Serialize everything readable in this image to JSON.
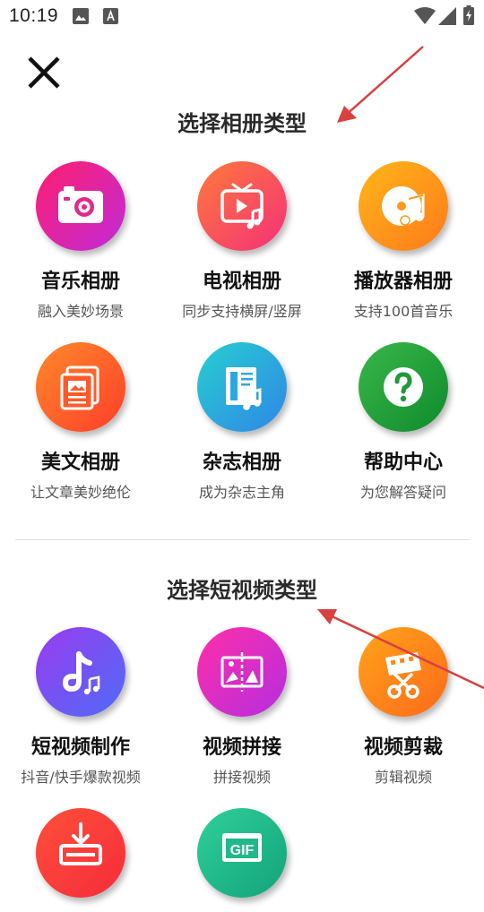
{
  "status_bar": {
    "time": "10:19",
    "icons": [
      "image-notification-icon",
      "a-text-notification-icon",
      "wifi-icon",
      "signal-icon",
      "battery-charging-icon"
    ]
  },
  "close_icon": "close-icon",
  "album_section": {
    "title": "选择相册类型",
    "items": [
      {
        "title": "音乐相册",
        "subtitle": "融入美妙场景",
        "icon": "camera-icon",
        "colors": [
          "#ff1e6e",
          "#c02bd9"
        ]
      },
      {
        "title": "电视相册",
        "subtitle": "同步支持横屏/竖屏",
        "icon": "tv-music-icon",
        "colors": [
          "#ff7a3a",
          "#f4307a"
        ]
      },
      {
        "title": "播放器相册",
        "subtitle": "支持100首音乐",
        "icon": "music-disc-icon",
        "colors": [
          "#ffb61a",
          "#ff7a1a"
        ]
      },
      {
        "title": "美文相册",
        "subtitle": "让文章美妙绝伦",
        "icon": "article-icon",
        "colors": [
          "#ff8a2a",
          "#ff3d2a"
        ]
      },
      {
        "title": "杂志相册",
        "subtitle": "成为杂志主角",
        "icon": "magazine-music-icon",
        "colors": [
          "#27cfd0",
          "#2f86e6"
        ]
      },
      {
        "title": "帮助中心",
        "subtitle": "为您解答疑问",
        "icon": "help-question-icon",
        "colors": [
          "#39b84a",
          "#0f8a2c"
        ]
      }
    ]
  },
  "video_section": {
    "title": "选择短视频类型",
    "items": [
      {
        "title": "短视频制作",
        "subtitle": "抖音/快手爆款视频",
        "icon": "tiktok-note-icon",
        "colors": [
          "#9a3bf0",
          "#4f6cf5"
        ]
      },
      {
        "title": "视频拼接",
        "subtitle": "拼接视频",
        "icon": "video-stitch-icon",
        "colors": [
          "#ff2fa8",
          "#b52de0"
        ]
      },
      {
        "title": "视频剪裁",
        "subtitle": "剪辑视频",
        "icon": "scissors-film-icon",
        "colors": [
          "#ffa41a",
          "#ff6a1a"
        ]
      },
      {
        "title": "",
        "subtitle": "",
        "icon": "download-icon",
        "colors": [
          "#ff4f3a",
          "#f52c3a"
        ]
      },
      {
        "title": "",
        "subtitle": "",
        "icon": "gif-icon",
        "colors": [
          "#2fd09a",
          "#13a37a"
        ]
      }
    ]
  },
  "annotation_color": "#d94040"
}
